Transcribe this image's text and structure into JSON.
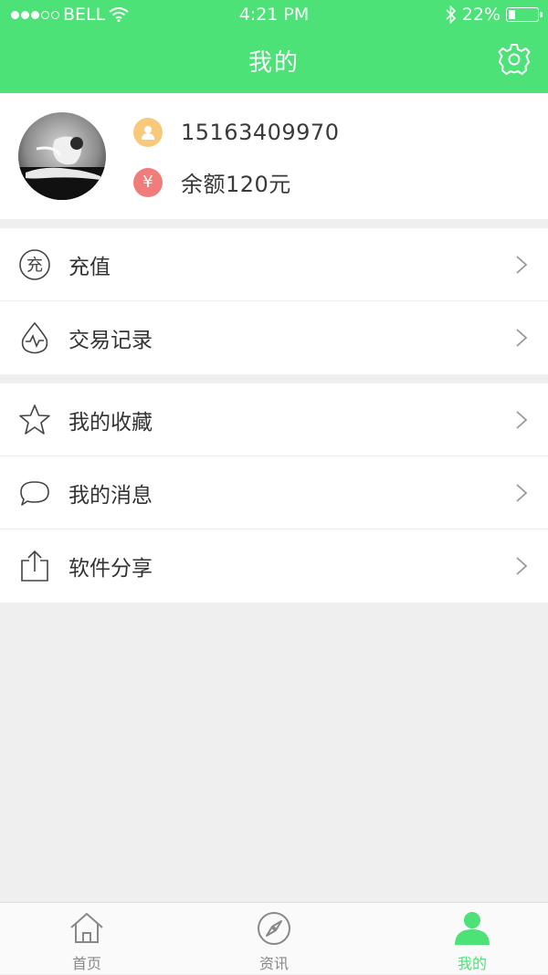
{
  "status_bar": {
    "carrier": "BELL",
    "time": "4:21 PM",
    "battery_percent": "22%",
    "battery_level": 0.22
  },
  "header": {
    "title": "我的",
    "settings_icon": "gear-icon"
  },
  "profile": {
    "phone": "15163409970",
    "balance": "余额120元",
    "phone_icon": "person-icon",
    "balance_icon": "yen-icon",
    "balance_symbol": "¥"
  },
  "menu_group_1": [
    {
      "label": "充值",
      "icon": "recharge-icon",
      "icon_text": "充"
    },
    {
      "label": "交易记录",
      "icon": "transaction-drop-icon"
    }
  ],
  "menu_group_2": [
    {
      "label": "我的收藏",
      "icon": "star-icon"
    },
    {
      "label": "我的消息",
      "icon": "chat-bubble-icon"
    },
    {
      "label": "软件分享",
      "icon": "share-icon"
    }
  ],
  "tabbar": [
    {
      "label": "首页",
      "icon": "home-icon",
      "active": false
    },
    {
      "label": "资讯",
      "icon": "compass-icon",
      "active": false
    },
    {
      "label": "我的",
      "icon": "user-icon",
      "active": true
    }
  ],
  "colors": {
    "accent": "#4ce277",
    "phone_badge": "#f9c97b",
    "balance_badge": "#f17c7c",
    "background": "#efefef"
  }
}
